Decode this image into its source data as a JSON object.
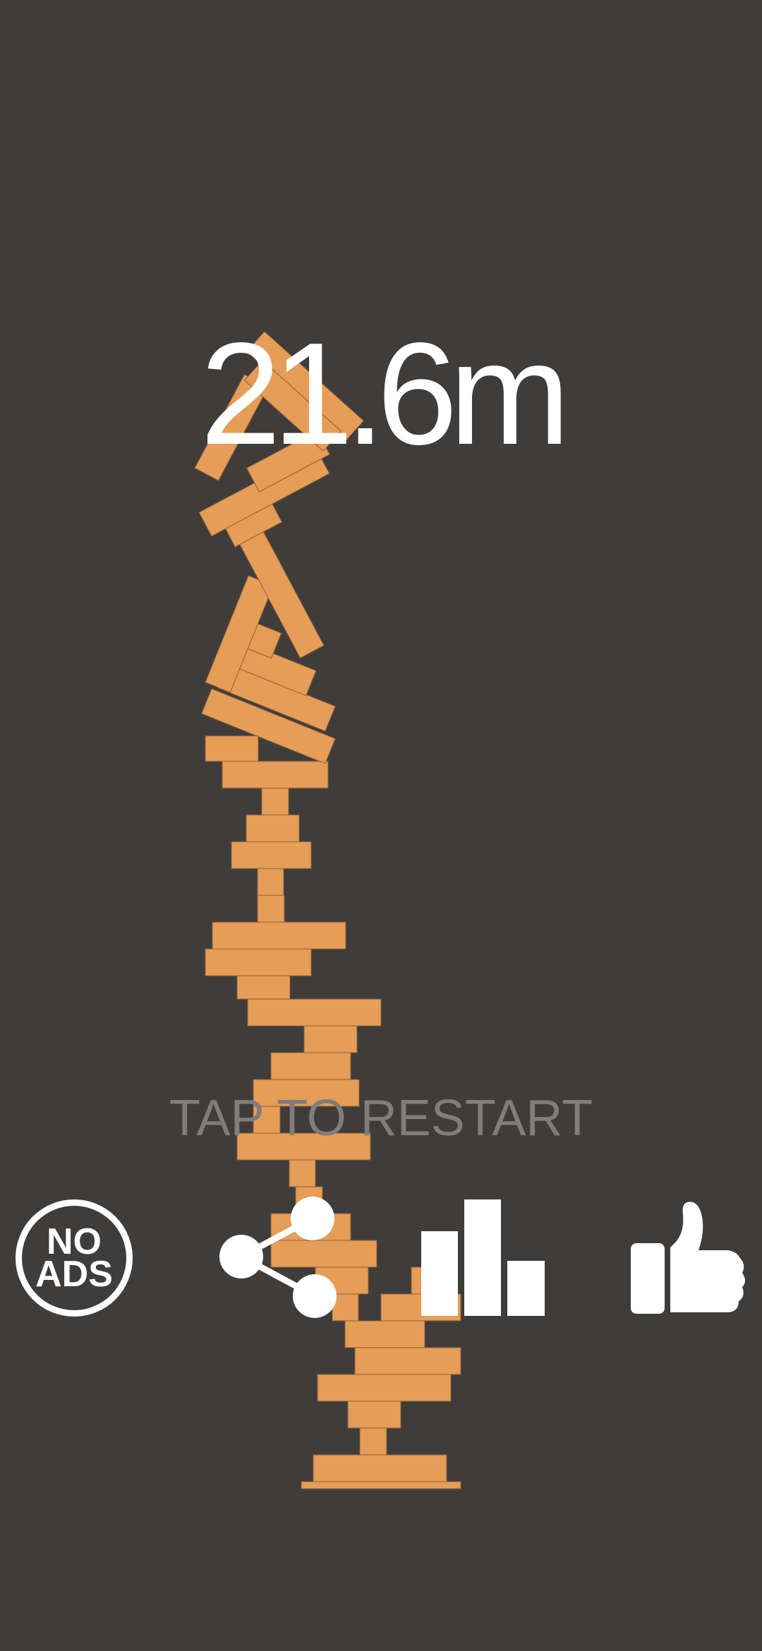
{
  "score": {
    "text": "21.6m"
  },
  "prompt": {
    "text": "TAP TO RESTART"
  },
  "buttons": {
    "no_ads": {
      "line1": "NO",
      "line2": "ADS",
      "icon": "no-ads-icon"
    },
    "share": {
      "icon": "share-icon"
    },
    "leaderboard": {
      "icon": "bar-chart-icon"
    },
    "like": {
      "icon": "thumbs-up-icon"
    }
  },
  "colors": {
    "background": "#3f3d3c",
    "block": "#e59d57",
    "score_text": "#ffffff",
    "prompt_text": "#807d7b",
    "icons": "#ffffff"
  }
}
